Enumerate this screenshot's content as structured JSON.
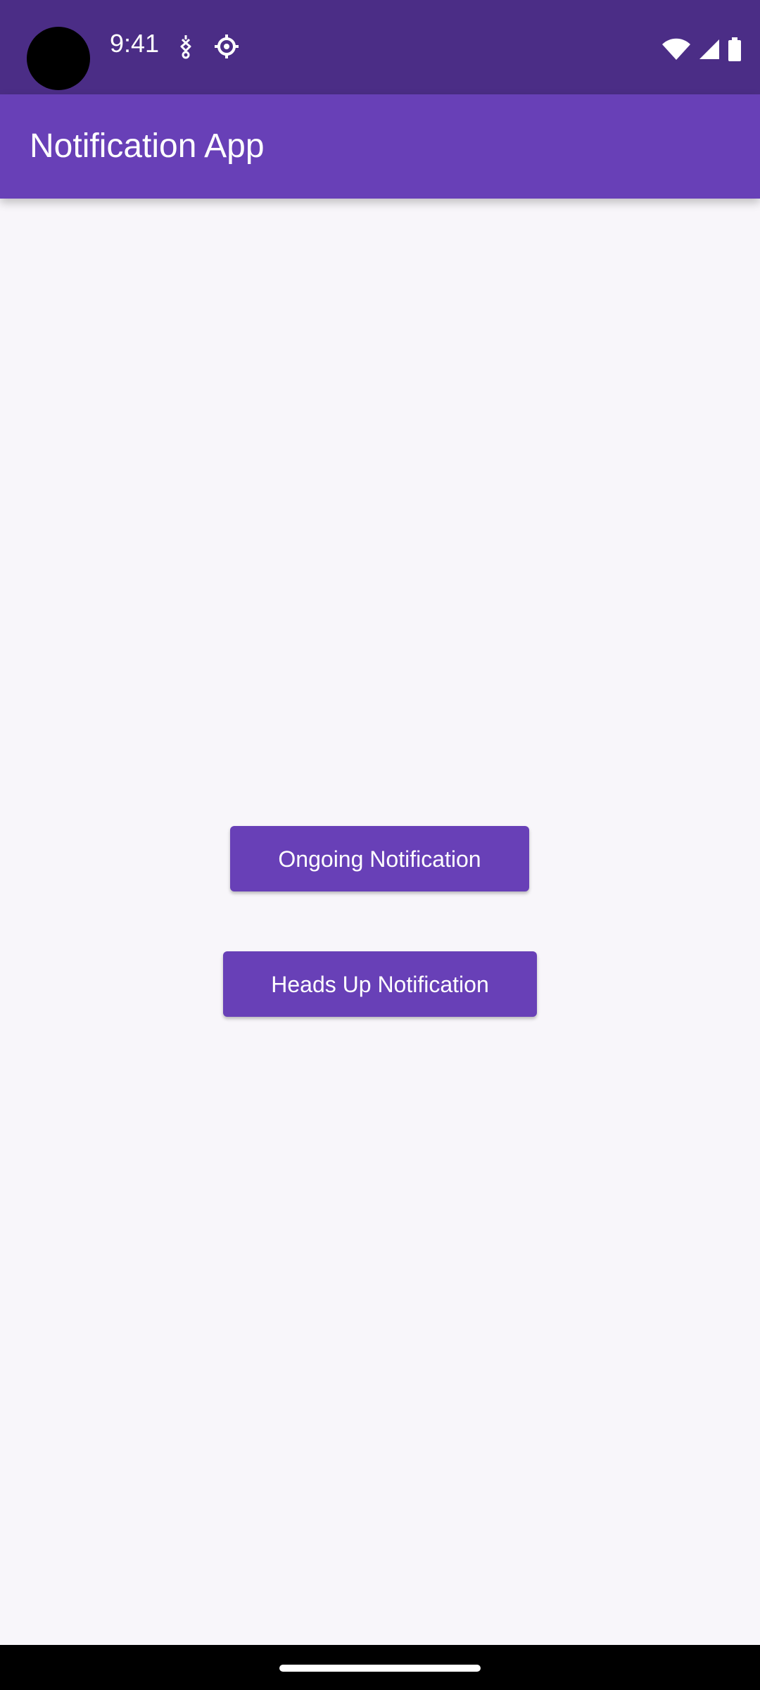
{
  "status_bar": {
    "time": "9:41",
    "icons": [
      "notification-icon",
      "settings-icon",
      "wifi-icon",
      "cell-signal-icon",
      "battery-icon"
    ]
  },
  "app_bar": {
    "title": "Notification App"
  },
  "buttons": {
    "ongoing_label": "Ongoing Notification",
    "headsup_label": "Heads Up Notification"
  },
  "colors": {
    "status_bar": "#4b2d86",
    "app_bar": "#6840b7",
    "button": "#6840b7",
    "background": "#f8f6fa"
  }
}
